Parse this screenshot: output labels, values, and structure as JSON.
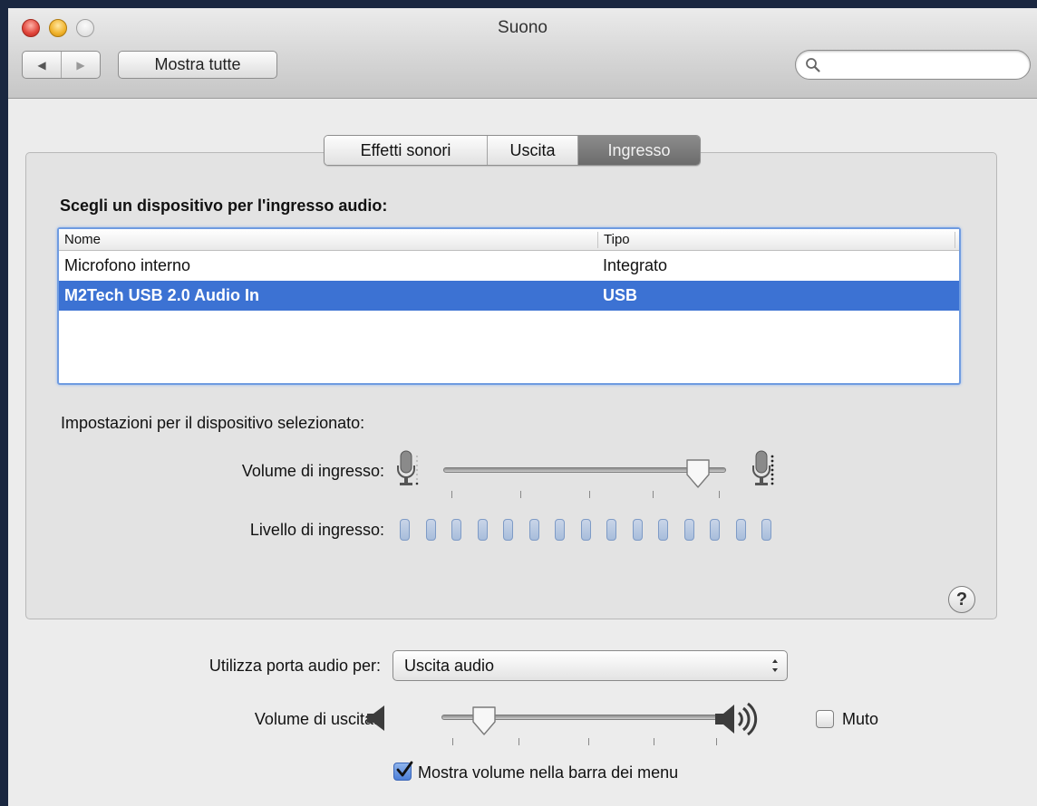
{
  "window": {
    "title": "Suono"
  },
  "toolbar": {
    "back_glyph": "◀",
    "forward_glyph": "▶",
    "show_all_label": "Mostra tutte",
    "search_placeholder": ""
  },
  "tabs": [
    {
      "label": "Effetti sonori",
      "active": false
    },
    {
      "label": "Uscita",
      "active": false
    },
    {
      "label": "Ingresso",
      "active": true
    }
  ],
  "input_panel": {
    "heading": "Scegli un dispositivo per l'ingresso audio:",
    "columns": {
      "name": "Nome",
      "type": "Tipo"
    },
    "devices": [
      {
        "name": "Microfono interno",
        "type": "Integrato",
        "selected": false
      },
      {
        "name": "M2Tech USB 2.0 Audio In",
        "type": "USB",
        "selected": true
      }
    ],
    "settings_heading": "Impostazioni per il dispositivo selezionato:",
    "input_volume_label": "Volume di ingresso:",
    "input_volume_value": 0.9,
    "input_level_label": "Livello di ingresso:",
    "input_level_bars": 15,
    "input_level_lit": 0,
    "help_glyph": "?"
  },
  "bottom": {
    "audio_port_label": "Utilizza porta audio per:",
    "audio_port_value": "Uscita audio",
    "output_volume_label": "Volume di uscita:",
    "output_volume_value": 0.15,
    "mute_label": "Muto",
    "mute_checked": false,
    "show_volume_label": "Mostra volume nella barra dei menu",
    "show_volume_checked": true
  },
  "colors": {
    "selection": "#3c72d3",
    "focus_ring": "#6f9be0",
    "active_tab": "#7a7a7a"
  }
}
